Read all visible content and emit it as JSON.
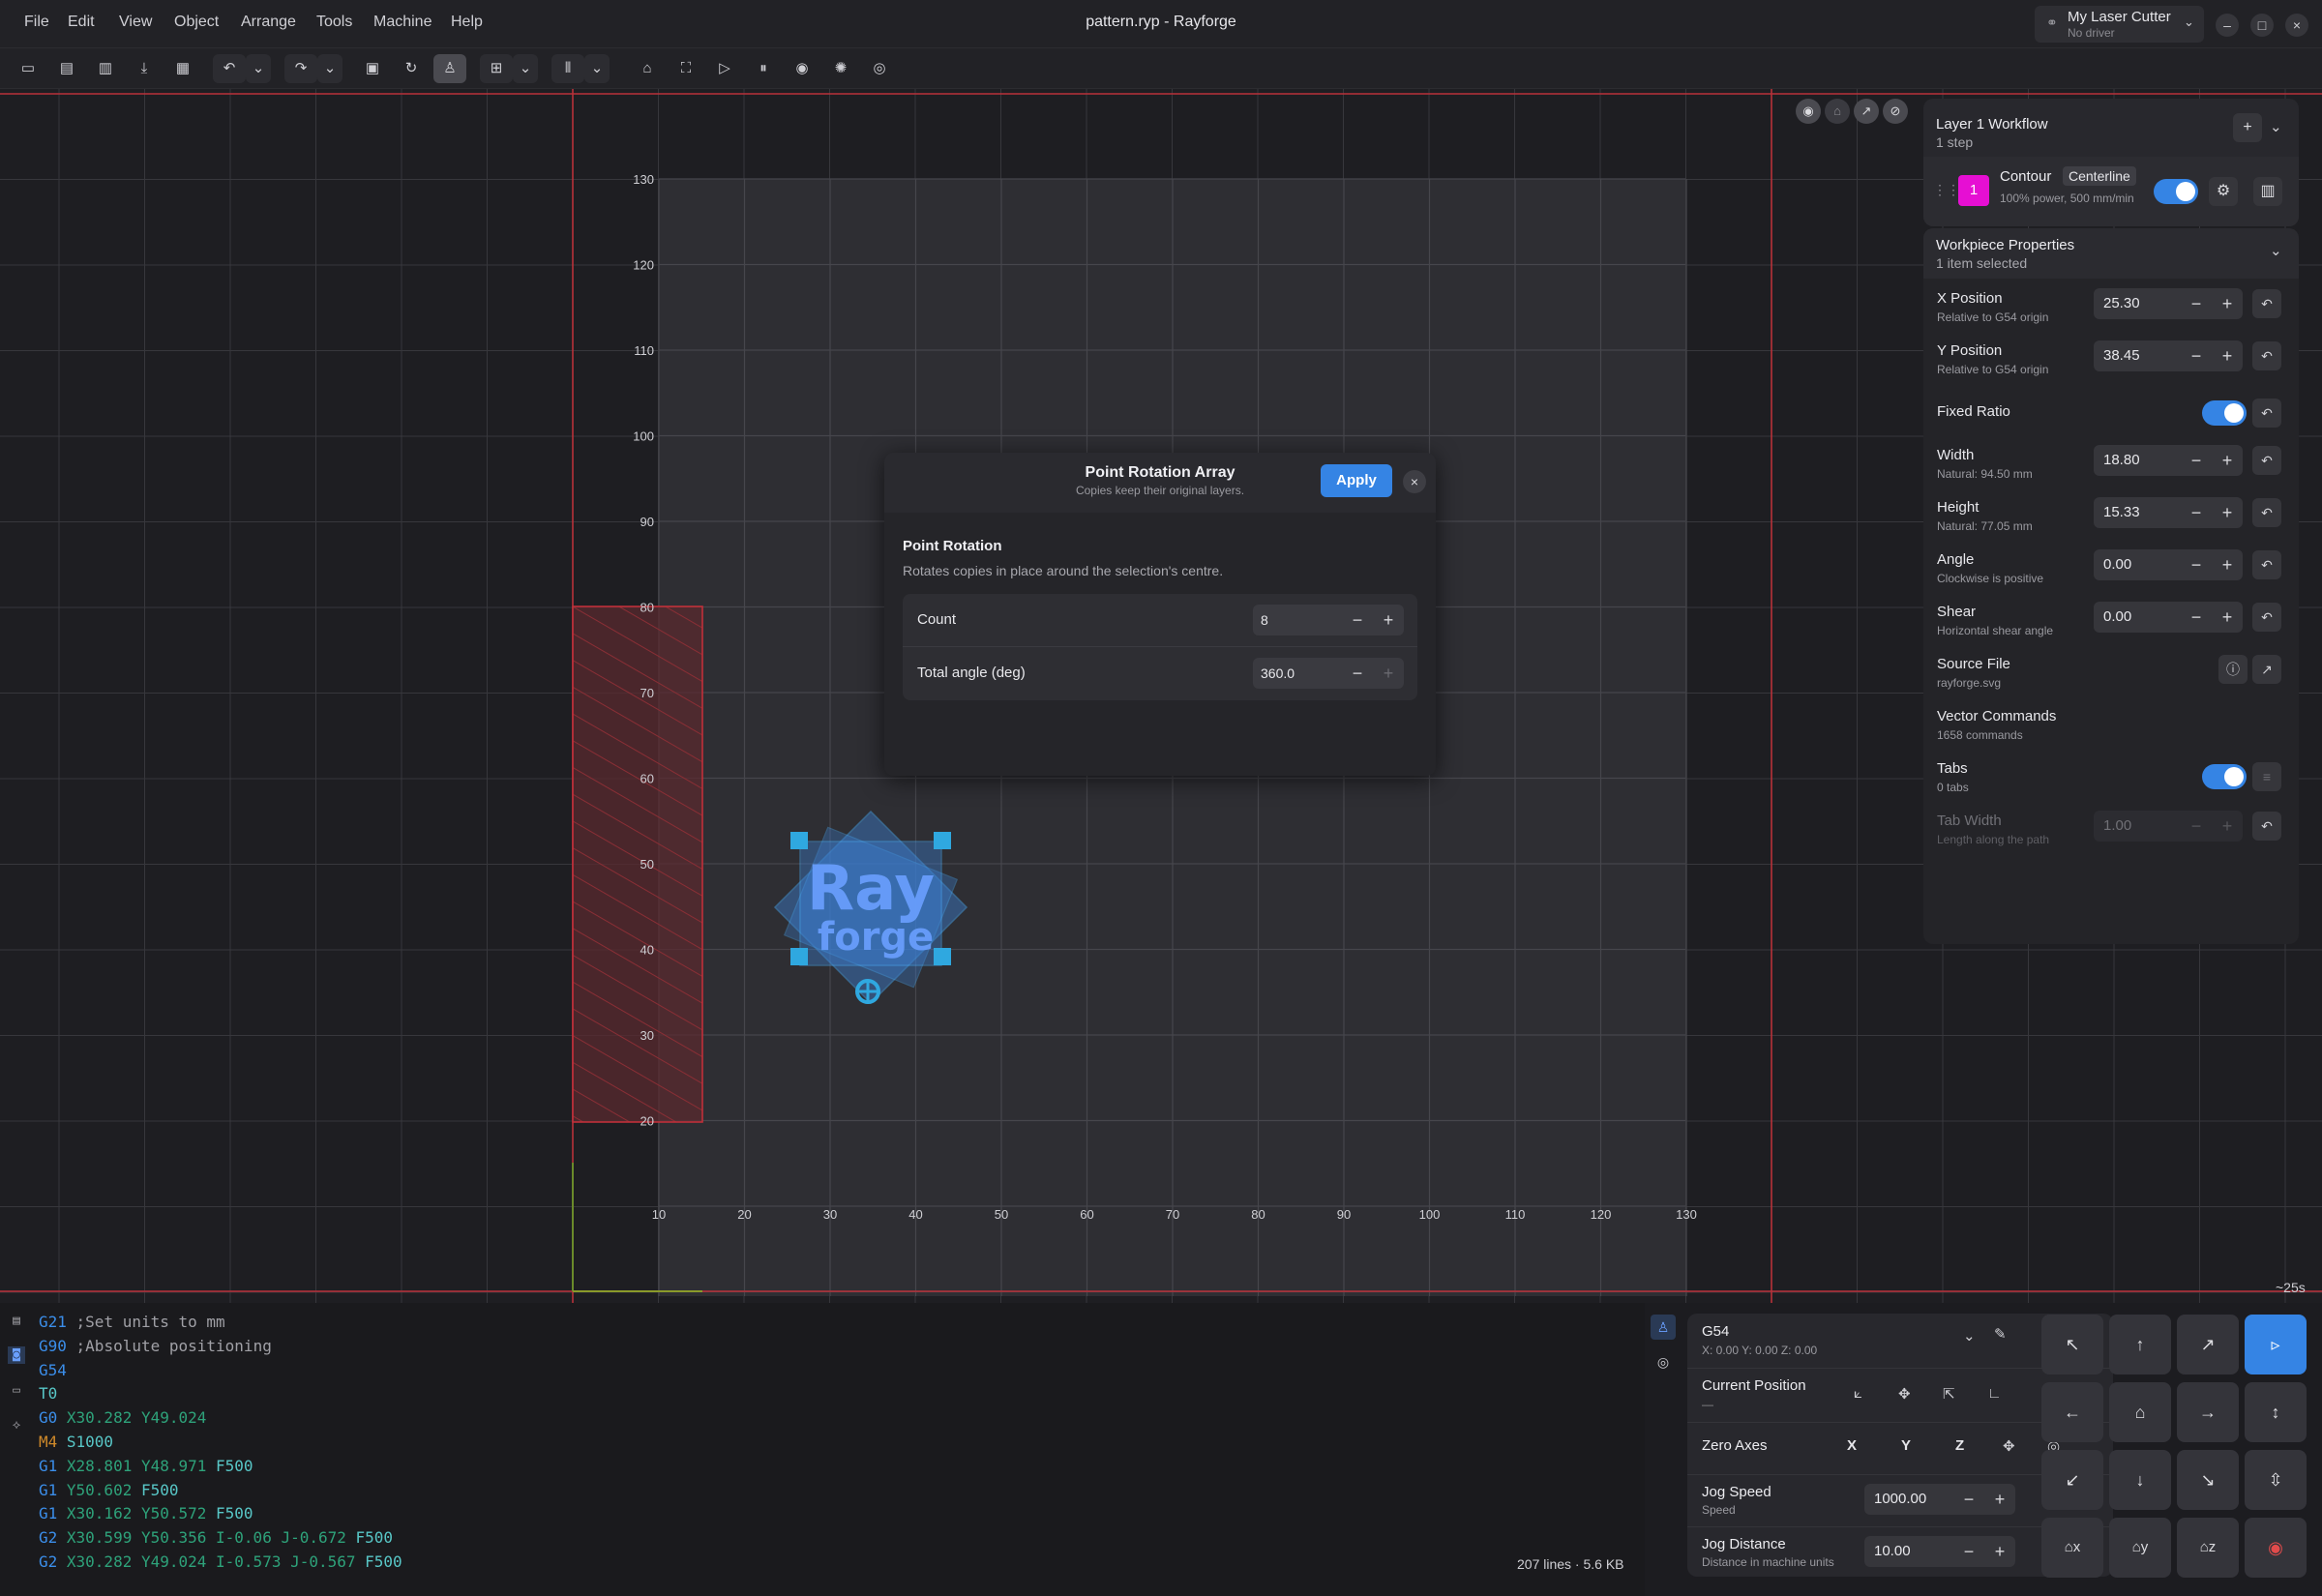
{
  "window": {
    "title": "pattern.ryp - Rayforge"
  },
  "menu": [
    "File",
    "Edit",
    "View",
    "Object",
    "Arrange",
    "Tools",
    "Machine",
    "Help"
  ],
  "machine": {
    "name": "My Laser Cutter",
    "driver": "No driver"
  },
  "toolbar_icons": [
    "open-icon",
    "save-icon",
    "save-as-icon",
    "import-icon",
    "export-icon",
    "undo-icon",
    "undo-history-icon",
    "redo-icon",
    "redo-history-icon",
    "frame-icon",
    "refresh-icon",
    "simulate-icon",
    "align-icon",
    "align-menu-icon",
    "distribute-icon",
    "distribute-menu-icon",
    "home-icon",
    "frame-job-icon",
    "run-icon",
    "pause-icon",
    "stop-icon",
    "laser-focus-icon",
    "target-icon"
  ],
  "canvas": {
    "x_ticks": [
      "10",
      "20",
      "30",
      "40",
      "50",
      "60",
      "70",
      "80",
      "90",
      "100",
      "110",
      "120",
      "130"
    ],
    "y_ticks": [
      "130",
      "120",
      "110",
      "100",
      "90",
      "80",
      "70",
      "60",
      "50",
      "40",
      "30",
      "20"
    ],
    "time_estimate": "~25s",
    "preview": {
      "line1": "Ray",
      "line2": "forge"
    }
  },
  "dialog": {
    "title": "Point Rotation Array",
    "subtitle": "Copies keep their original layers.",
    "apply": "Apply",
    "section_title": "Point Rotation",
    "section_desc": "Rotates copies in place around the selection's centre.",
    "count_label": "Count",
    "count_value": "8",
    "angle_label": "Total angle (deg)",
    "angle_value": "360.0"
  },
  "workflow": {
    "title": "Layer 1 Workflow",
    "subtitle": "1 step",
    "step": {
      "number": "1",
      "name": "Contour",
      "tag": "Centerline",
      "detail": "100% power, 500 mm/min",
      "color": "#e60fd3"
    }
  },
  "properties": {
    "title": "Workpiece Properties",
    "subtitle": "1 item selected",
    "x_label": "X Position",
    "x_sub": "Relative to G54 origin",
    "x_value": "25.30",
    "y_label": "Y Position",
    "y_sub": "Relative to G54 origin",
    "y_value": "38.45",
    "fixed_ratio": "Fixed Ratio",
    "width_label": "Width",
    "width_sub": "Natural: 94.50 mm",
    "width_value": "18.80",
    "height_label": "Height",
    "height_sub": "Natural: 77.05 mm",
    "height_value": "15.33",
    "angle_label": "Angle",
    "angle_sub": "Clockwise is positive",
    "angle_value": "0.00",
    "shear_label": "Shear",
    "shear_sub": "Horizontal shear angle",
    "shear_value": "0.00",
    "source_label": "Source File",
    "source_sub": "rayforge.svg",
    "vector_label": "Vector Commands",
    "vector_sub": "1658 commands",
    "tabs_label": "Tabs",
    "tabs_sub": "0 tabs",
    "tabwidth_label": "Tab Width",
    "tabwidth_sub": "Length along the path",
    "tabwidth_value": "1.00"
  },
  "gcode": {
    "lines": [
      [
        [
          "kw",
          "G21"
        ],
        [
          "cm",
          " ;Set units to mm"
        ]
      ],
      [
        [
          "kw",
          "G90"
        ],
        [
          "cm",
          " ;Absolute positioning"
        ]
      ],
      [
        [
          "kw",
          "G54"
        ]
      ],
      [
        [
          "fe",
          "T0"
        ]
      ],
      [
        [
          "kw",
          "G0"
        ],
        [
          "num",
          " X30.282 Y49.024"
        ]
      ],
      [
        [
          "m",
          "M4"
        ],
        [
          "fe",
          " S1000"
        ]
      ],
      [
        [
          "kw",
          "G1"
        ],
        [
          "num",
          " X28.801 Y48.971"
        ],
        [
          "fe",
          " F500"
        ]
      ],
      [
        [
          "kw",
          "G1"
        ],
        [
          "num",
          " Y50.602"
        ],
        [
          "fe",
          " F500"
        ]
      ],
      [
        [
          "kw",
          "G1"
        ],
        [
          "num",
          " X30.162 Y50.572"
        ],
        [
          "fe",
          " F500"
        ]
      ],
      [
        [
          "kw",
          "G2"
        ],
        [
          "num",
          " X30.599 Y50.356 I-0.06 J-0.672"
        ],
        [
          "fe",
          " F500"
        ]
      ],
      [
        [
          "kw",
          "G2"
        ],
        [
          "num",
          " X30.282 Y49.024 I-0.573 J-0.567"
        ],
        [
          "fe",
          " F500"
        ]
      ]
    ],
    "stats": "207 lines · 5.6 KB"
  },
  "control": {
    "wcs": "G54",
    "wcs_coords": "X: 0.00   Y: 0.00   Z: 0.00",
    "current_position": "Current Position",
    "current_position_sub": "—",
    "zero_axes": "Zero Axes",
    "axes": [
      "X",
      "Y",
      "Z"
    ],
    "jog_speed_label": "Jog Speed",
    "jog_speed_sub": "Speed",
    "jog_speed_value": "1000.00",
    "jog_dist_label": "Jog Distance",
    "jog_dist_sub": "Distance in machine units",
    "jog_dist_value": "10.00"
  },
  "colors": {
    "accent": "#3584e4",
    "grid": "#3a3a3f",
    "machine_limit": "#c0303a",
    "selection": "#3da9ff"
  }
}
